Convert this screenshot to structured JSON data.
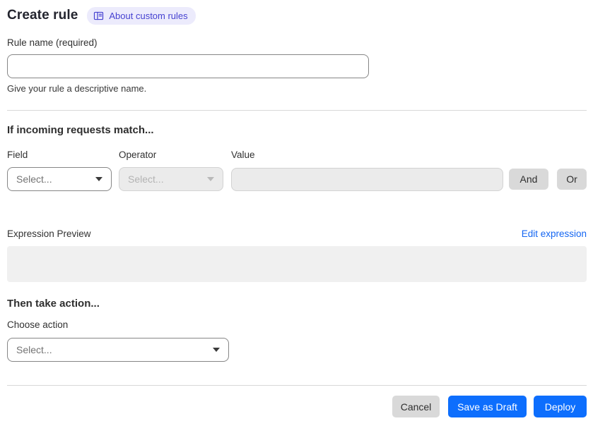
{
  "page": {
    "title": "Create rule",
    "about_badge_label": "About custom rules"
  },
  "rule_name": {
    "label": "Rule name (required)",
    "value": "",
    "help": "Give your rule a descriptive name."
  },
  "match_section": {
    "heading": "If incoming requests match...",
    "field_label": "Field",
    "operator_label": "Operator",
    "value_label": "Value",
    "field_placeholder": "Select...",
    "operator_placeholder": "Select...",
    "value_text": "",
    "and_button": "And",
    "or_button": "Or"
  },
  "expression": {
    "label": "Expression Preview",
    "edit_link": "Edit expression",
    "preview_text": ""
  },
  "action_section": {
    "heading": "Then take action...",
    "choose_label": "Choose action",
    "action_placeholder": "Select..."
  },
  "footer": {
    "cancel": "Cancel",
    "save_draft": "Save as Draft",
    "deploy": "Deploy"
  },
  "colors": {
    "primary_blue": "#0d6efd",
    "link_blue": "#1466f2",
    "badge_background": "#ecebfc",
    "badge_text": "#4642d1",
    "gray_button": "#d9d9d9",
    "disabled_background": "#ebebeb",
    "preview_background": "#f0f0f0"
  }
}
